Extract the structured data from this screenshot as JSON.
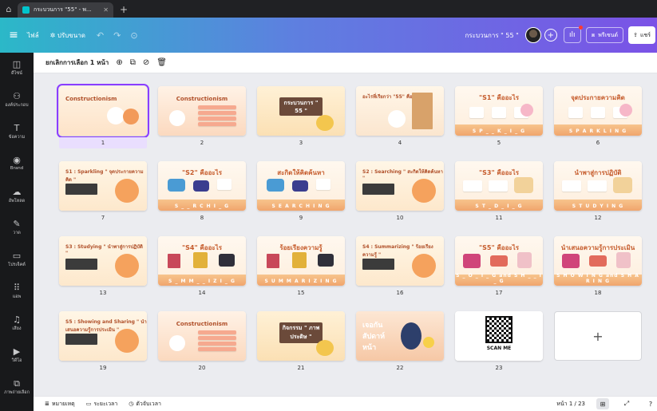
{
  "browser": {
    "tab_title": "กระบวนการ \"55\" - พ...",
    "new_tab": "+",
    "home_icon": "home-icon"
  },
  "topbar": {
    "menu_icon": "≡",
    "file": "ไฟล์",
    "resize": "✲ ปรับขนาด",
    "undo": "↶",
    "redo": "↷",
    "sync": "⊙",
    "doc_title": "กระบวนการ \" 55 \"",
    "add": "+",
    "analytics": "ılı",
    "present": "พรีเซนต์",
    "share": "แชร์"
  },
  "rail": [
    {
      "icon": "◫",
      "label": "ดีไซน์"
    },
    {
      "icon": "⚇",
      "label": "องค์ประกอบ"
    },
    {
      "icon": "T",
      "label": "ข้อความ"
    },
    {
      "icon": "◉",
      "label": "Brand"
    },
    {
      "icon": "☁",
      "label": "อัพโหลด"
    },
    {
      "icon": "✎",
      "label": "วาด"
    },
    {
      "icon": "▭",
      "label": "โปรเจ็คต์"
    },
    {
      "icon": "⠿",
      "label": "แอพ"
    },
    {
      "icon": "♫",
      "label": "เสียง"
    },
    {
      "icon": "▶",
      "label": "วิดีโอ"
    },
    {
      "icon": "⧉",
      "label": "ภาพถ่ายเลือก"
    }
  ],
  "toolbar": {
    "deselect": "ยกเลิกการเลือก 1 หน้า",
    "add_icon": "⊕",
    "copy_icon": "⧉",
    "hide_icon": "⊘",
    "delete_icon": "🗑"
  },
  "slides": [
    {
      "num": "1",
      "title": "Constructionism",
      "band": "",
      "style": "intro"
    },
    {
      "num": "2",
      "title": "Constructionism",
      "band": "",
      "style": "list"
    },
    {
      "num": "3",
      "title": "กระบวนการ \" 55 \"",
      "band": "",
      "style": "sign"
    },
    {
      "num": "4",
      "title": "อะไรที่เรียกว่า \"55\" คืออะไร ?",
      "band": "",
      "style": "door"
    },
    {
      "num": "5",
      "title": "\"S1\" คืออะไร",
      "band": "S P _ _ K _ I _ G",
      "style": "cards"
    },
    {
      "num": "6",
      "title": "จุดประกายความคิด",
      "band": "S P A R K L I N G",
      "style": "cards"
    },
    {
      "num": "7",
      "title": "S1 : Sparkling \" จุดประกายความคิด \"",
      "band": "",
      "style": "photo"
    },
    {
      "num": "8",
      "title": "\"S2\" คืออะไร",
      "band": "S _ _ R C H I _ G",
      "style": "objects"
    },
    {
      "num": "9",
      "title": "สะกิดให้คิดค้นหา",
      "band": "S E A R C H I N G",
      "style": "objects"
    },
    {
      "num": "10",
      "title": "S2 : Searching \" สะกิดให้คิดค้นหา \"",
      "band": "",
      "style": "photo"
    },
    {
      "num": "11",
      "title": "\"S3\" คืออะไร",
      "band": "S T _ D _ I _ G",
      "style": "study"
    },
    {
      "num": "12",
      "title": "นำพาสู่การปฏิบัติ",
      "band": "S T U D Y I N G",
      "style": "study"
    },
    {
      "num": "13",
      "title": "S3 : Studying \" นำพาสู่การปฏิบัติ \"",
      "band": "",
      "style": "photo"
    },
    {
      "num": "14",
      "title": "\"S4\" คืออะไร",
      "band": "S _ M M _ _ I Z I _ G",
      "style": "pics"
    },
    {
      "num": "15",
      "title": "ร้อยเรียงความรู้",
      "band": "S U M M A R I Z I N G",
      "style": "pics"
    },
    {
      "num": "16",
      "title": "S4 : Summarizing \" ร้อยเรียงความรู้ \"",
      "band": "",
      "style": "photo"
    },
    {
      "num": "17",
      "title": "\"S5\" คืออะไร",
      "band": "S _ O _ I _ G and S H _ _ I _ G",
      "style": "show"
    },
    {
      "num": "18",
      "title": "นำเสนอความรู้การประเมิน",
      "band": "S H O W I N G and S H A R I N G",
      "style": "show"
    },
    {
      "num": "19",
      "title": "S5 : Showing and Sharing \" นำเสนอความรู้การประเมิน \"",
      "band": "",
      "style": "photo"
    },
    {
      "num": "20",
      "title": "Constructionism",
      "band": "",
      "style": "list"
    },
    {
      "num": "21",
      "title": "กิจกรรม \" ภาพประดิษ \"",
      "band": "",
      "style": "sign"
    },
    {
      "num": "22",
      "title": "เจอกัน สัปดาห์หน้า",
      "band": "",
      "style": "bye"
    },
    {
      "num": "23",
      "title": "SCAN ME",
      "band": "",
      "style": "qr"
    }
  ],
  "add_page": "+",
  "footer": {
    "notes": "หมายเหตุ",
    "duration": "ระยะเวลา",
    "timer": "ตัวจับเวลา",
    "page_info": "หน้า 1 / 23",
    "grid_icon": "⊞",
    "expand_icon": "⤢",
    "help_icon": "?"
  },
  "colors": {
    "accent": "#8b3dff",
    "topbar_start": "#2bb8c8",
    "topbar_end": "#7b52e6",
    "rail_bg": "#18191b",
    "slide_title": "#c55a2a"
  }
}
